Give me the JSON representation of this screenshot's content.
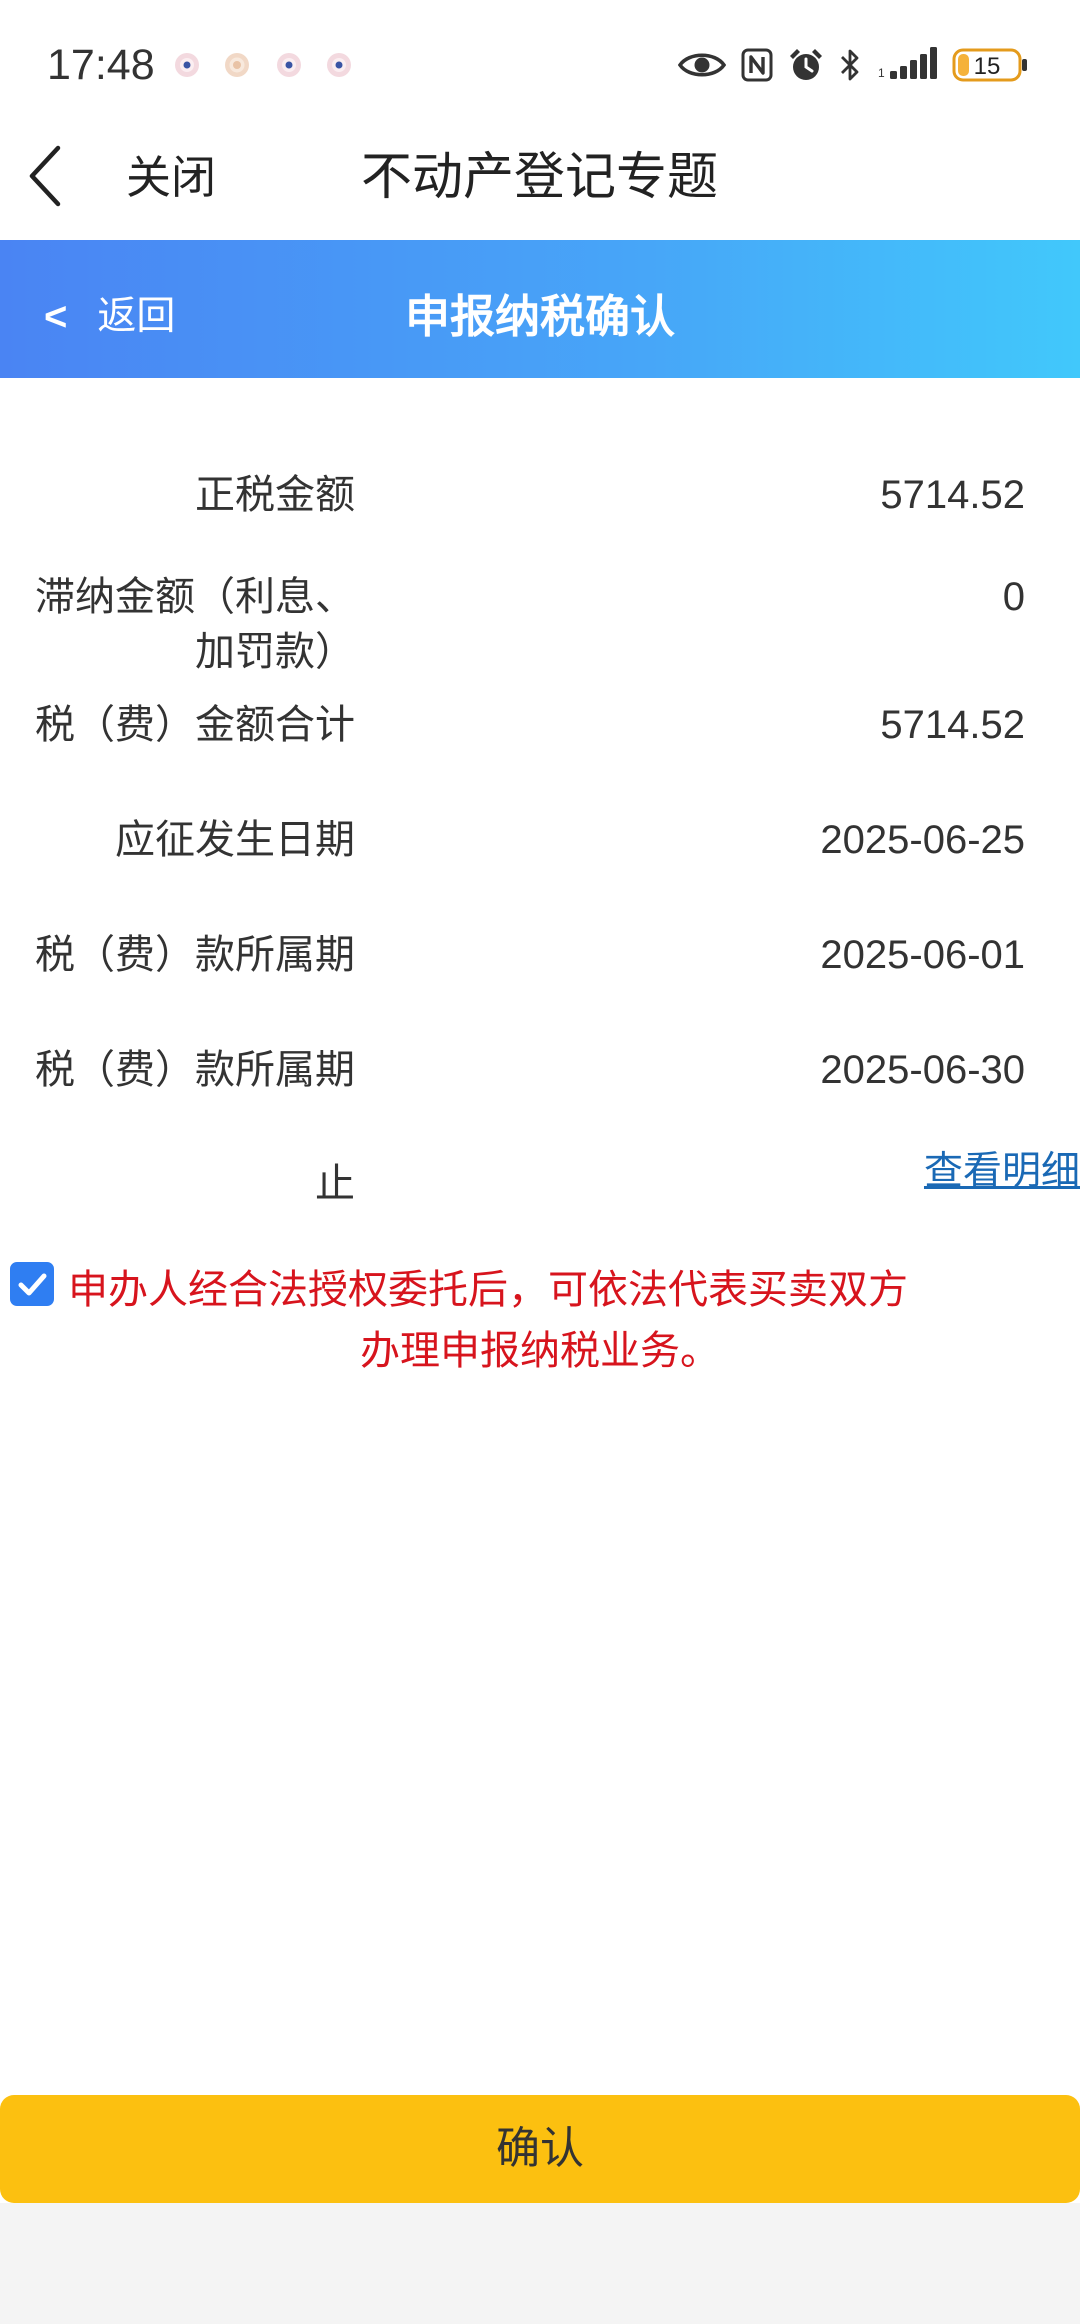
{
  "status_bar": {
    "time": "17:48",
    "notification_icons": [
      "app-notification-icon",
      "app-notification-icon",
      "app-notification-icon",
      "app-notification-icon"
    ],
    "system_icons": [
      "eye-icon",
      "nfc-icon",
      "alarm-icon",
      "bluetooth-icon",
      "signal-icon",
      "battery-icon"
    ],
    "signal_sim_label": "1",
    "battery_level": "15"
  },
  "nav": {
    "back_icon": "chevron-left-icon",
    "close_label": "关闭",
    "title": "不动产登记专题"
  },
  "sub_header": {
    "back_arrow": "<",
    "back_label": "返回",
    "title": "申报纳税确认"
  },
  "rows": [
    {
      "label": "正税金额",
      "value": "5714.52"
    },
    {
      "label": "滞纳金额（利息、加罚款）",
      "value": "0"
    },
    {
      "label": "税（费）金额合计",
      "value": "5714.52"
    },
    {
      "label": "应征发生日期",
      "value": "2025-06-25"
    },
    {
      "label": "税（费）款所属期",
      "value": "2025-06-01"
    },
    {
      "label": "税（费）款所属期",
      "value": "2025-06-30"
    },
    {
      "label": "止"
    }
  ],
  "detail_link": "查看明细",
  "consent": {
    "checked": true,
    "line1": "申办人经合法授权委托后，可依法代表买卖双方",
    "line2": "办理申报纳税业务。"
  },
  "confirm_label": "确认",
  "colors": {
    "header_gradient_start": "#4a84f3",
    "header_gradient_end": "#41c8fb",
    "checkbox_blue": "#2f7ef2",
    "consent_red": "#d7141d",
    "link_blue": "#1a69b5",
    "confirm_yellow": "#fcc010"
  }
}
